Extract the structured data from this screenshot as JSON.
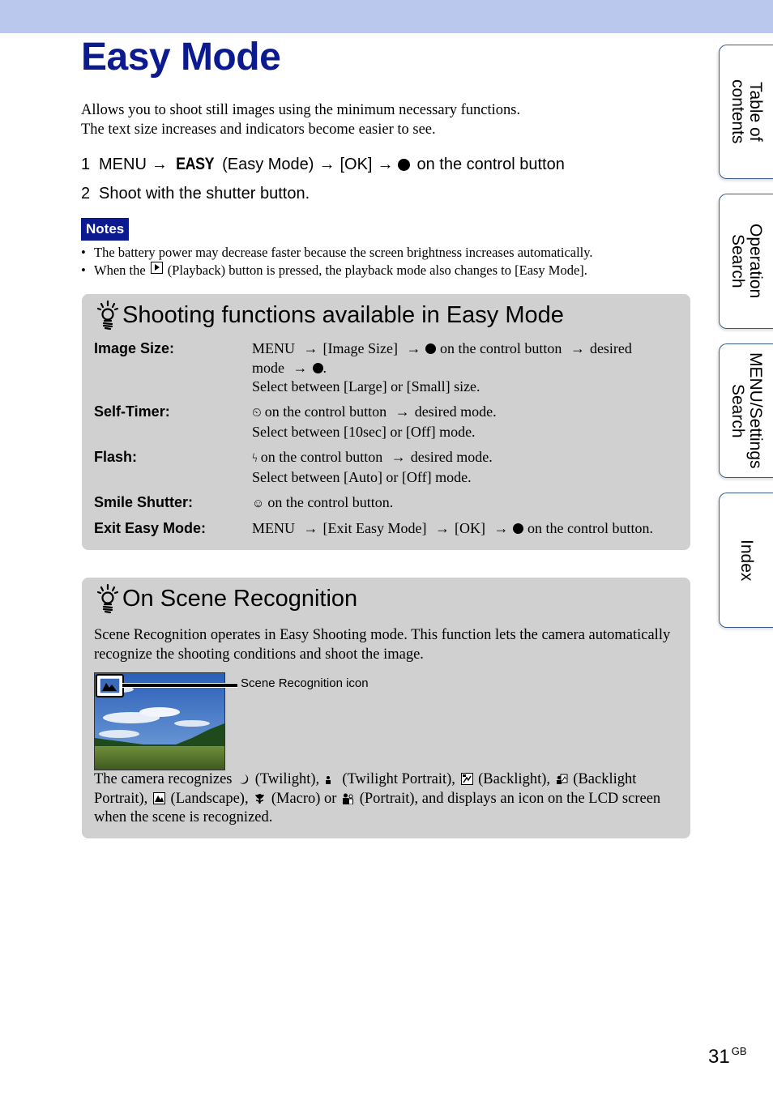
{
  "header": {
    "title": "Easy Mode"
  },
  "intro": [
    "Allows you to shoot still images using the minimum necessary functions.",
    "The text size increases and indicators become easier to see."
  ],
  "steps": {
    "step1": {
      "num": "1",
      "menu": "MENU",
      "easy_icon": "EASY",
      "easy_label": "(Easy Mode)",
      "ok": "[OK]",
      "tail": "on the control button"
    },
    "step2": {
      "num": "2",
      "text": "Shoot with the shutter button."
    },
    "arrow": "→"
  },
  "notes": {
    "label": "Notes",
    "bullet": "•",
    "items": [
      {
        "text": "The battery power may decrease faster because the screen brightness increases automatically."
      },
      {
        "pre": "When the",
        "icon": "playback-icon",
        "post": "(Playback) button is pressed, the playback mode also changes to [Easy Mode]."
      }
    ]
  },
  "shooting_functions": {
    "title": "Shooting functions available in Easy Mode",
    "rows": [
      {
        "label": "Image Size:",
        "line1a": "MENU",
        "line1b": "[Image Size]",
        "line1c": "on the control button",
        "line1d": "desired",
        "line2a": "mode",
        "line3": "Select between [Large] or [Small] size."
      },
      {
        "label": "Self-Timer:",
        "icon": "⏲",
        "line1": "on the control button",
        "line1b": "desired mode.",
        "line2": "Select between [10sec] or [Off] mode."
      },
      {
        "label": "Flash:",
        "icon": "ϟ",
        "line1": "on the control button",
        "line1b": "desired mode.",
        "line2": "Select between [Auto] or [Off] mode."
      },
      {
        "label": "Smile Shutter:",
        "icon": "☺",
        "line1": "on the control button."
      },
      {
        "label": "Exit Easy Mode:",
        "a": "MENU",
        "b": "[Exit Easy Mode]",
        "c": "[OK]",
        "d": "on the control button."
      }
    ]
  },
  "scene_recognition": {
    "title": "On Scene Recognition",
    "text": "Scene Recognition operates in Easy Shooting mode. This function lets the camera automatically recognize the shooting conditions and shoot the image.",
    "icon_label": "Scene Recognition icon",
    "recognizes": {
      "intro": "The camera recognizes",
      "twilight": "(Twilight),",
      "twilight_portrait": "(Twilight Portrait),",
      "backlight": "(Backlight),",
      "backlight_portrait": "(Backlight Portrait),",
      "landscape": "(Landscape),",
      "macro": "(Macro) or",
      "portrait": "(Portrait), and displays an icon on the LCD screen when the scene is recognized."
    }
  },
  "side_tabs": [
    {
      "label": "Table of\ncontents"
    },
    {
      "label": "Operation\nSearch"
    },
    {
      "label": "MENU/Settings\nSearch"
    },
    {
      "label": "Index"
    }
  ],
  "footer": {
    "page": "31",
    "suffix": "GB"
  },
  "colors": {
    "accent": "#0b1a8f",
    "topbar": "#b9c8ec",
    "panel": "#d0d0d0",
    "tab_border": "#3a5a8c"
  }
}
